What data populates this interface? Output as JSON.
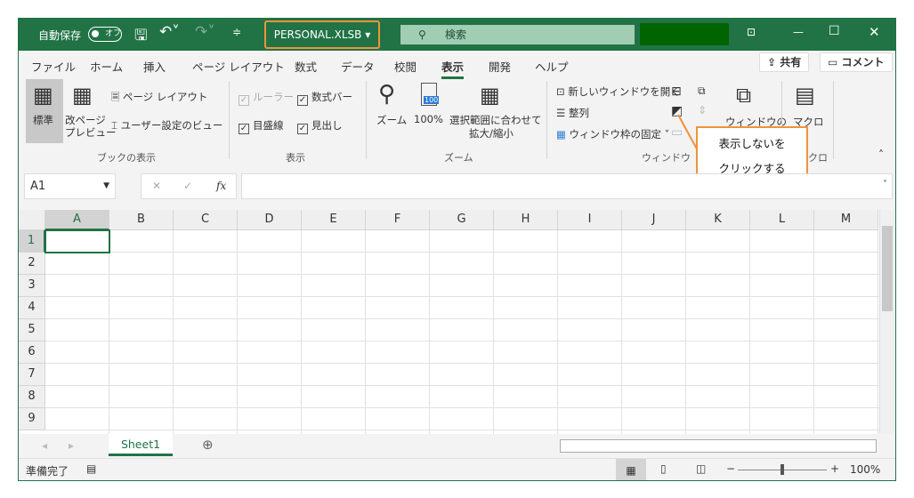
{
  "titlebar": {
    "autosave_label": "自動保存",
    "autosave_state": "オフ",
    "file_name": "PERSONAL.XLSB",
    "search_placeholder": "検索"
  },
  "tabs": [
    "ファイル",
    "ホーム",
    "挿入",
    "ページ レイアウト",
    "数式",
    "データ",
    "校閲",
    "表示",
    "開発",
    "ヘルプ"
  ],
  "active_tab": "表示",
  "share_label": "共有",
  "comment_label": "コメント",
  "ribbon": {
    "book_view": {
      "normal": "標準",
      "page_break": [
        "改ページ",
        "プレビュー"
      ],
      "page_layout": "ページ レイアウト",
      "custom_views": "ユーザー設定のビュー",
      "group": "ブックの表示"
    },
    "show": {
      "ruler": "ルーラー",
      "formula_bar": "数式バー",
      "gridlines": "目盛線",
      "headings": "見出し",
      "group": "表示"
    },
    "zoom": {
      "zoom": "ズーム",
      "hundred": "100%",
      "badge": "100",
      "fit": [
        "選択範囲に合わせて",
        "拡大/縮小"
      ],
      "group": "ズーム"
    },
    "window": {
      "new_window": "新しいウィンドウを開く",
      "arrange": "整列",
      "freeze": "ウィンドウ枠の固定",
      "switch": "ウィンドウの",
      "group": "ウィンドウ"
    },
    "macro": {
      "label": "マクロ",
      "group": "マクロ"
    }
  },
  "callout": [
    "表示しないを",
    "クリックする"
  ],
  "name_box": "A1",
  "formula_icons": {
    "cancel": "✕",
    "enter": "✓",
    "fx": "fx"
  },
  "columns": [
    "A",
    "B",
    "C",
    "D",
    "E",
    "F",
    "G",
    "H",
    "I",
    "J",
    "K",
    "L",
    "M"
  ],
  "rows": [
    "1",
    "2",
    "3",
    "4",
    "5",
    "6",
    "7",
    "8",
    "9"
  ],
  "sheet_tab": "Sheet1",
  "status": {
    "ready": "準備完了",
    "zoom": "100%"
  }
}
